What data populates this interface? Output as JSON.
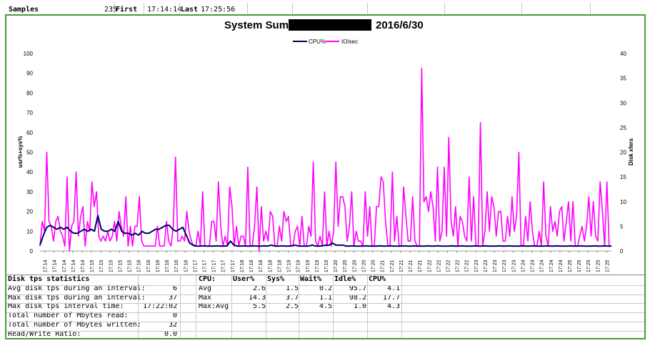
{
  "sheet_header": {
    "samples_label": "Samples",
    "samples_value": "235",
    "first_label": "First",
    "first_value": "17:14:14",
    "last_label": "Last",
    "last_value": "17:25:56"
  },
  "chart_data": {
    "type": "line",
    "title": "System Summary",
    "title_date": "2016/6/30",
    "title_redacted": true,
    "ylabel": "usr%+sys%",
    "y2label": "Disk xfers",
    "ylim": [
      0,
      100
    ],
    "y2lim": [
      0,
      40
    ],
    "yticks": [
      0,
      10,
      20,
      30,
      40,
      50,
      60,
      70,
      80,
      90,
      100
    ],
    "y2ticks": [
      0,
      5,
      10,
      15,
      20,
      25,
      30,
      35,
      40
    ],
    "legend_position": "top-center",
    "colors": {
      "cpu": "#000066",
      "io": "#ff00ff"
    },
    "x": [
      "17:14",
      "17:14",
      "17:14",
      "17:14",
      "17:14",
      "17:15",
      "17:15",
      "17:15",
      "17:15",
      "17:15",
      "17:16",
      "17:16",
      "17:16",
      "17:16",
      "17:16",
      "17:16",
      "17:17",
      "17:17",
      "17:17",
      "17:17",
      "17:17",
      "17:18",
      "17:18",
      "17:18",
      "17:18",
      "17:18",
      "17:19",
      "17:19",
      "17:19",
      "17:19",
      "17:19",
      "17:20",
      "17:20",
      "17:20",
      "17:20",
      "17:20",
      "17:21",
      "17:21",
      "17:21",
      "17:21",
      "17:21",
      "17:22",
      "17:22",
      "17:22",
      "17:22",
      "17:22",
      "17:23",
      "17:23",
      "17:23",
      "17:23",
      "17:23",
      "17:24",
      "17:24",
      "17:24",
      "17:24",
      "17:24",
      "17:25",
      "17:25",
      "17:25",
      "17:25",
      "17:25"
    ],
    "series": [
      {
        "name": "CPU%",
        "axis": "left",
        "values": [
          3,
          8,
          12,
          13,
          12,
          11,
          12,
          11,
          12,
          10,
          9,
          9,
          10,
          11,
          10,
          11,
          10,
          18,
          11,
          10,
          10,
          11,
          10,
          15,
          10,
          9,
          9,
          8,
          9,
          8,
          10,
          9,
          9,
          10,
          11,
          11,
          12,
          13,
          13,
          11,
          10,
          11,
          12,
          8,
          4,
          3,
          2.5,
          2.5,
          2.6,
          2.5,
          2.5,
          2.5,
          2.6,
          2.5,
          2.5,
          2.6,
          5,
          3,
          2.5,
          2.5,
          2.6,
          2.5,
          2.5,
          2.6,
          2.5,
          2.5,
          2.6,
          2.5,
          3,
          2.5,
          2.5,
          2.6,
          2.5,
          2.5,
          2.6,
          3,
          2.5,
          2.5,
          2.5,
          2.5,
          3,
          2.5,
          2.5,
          2.6,
          3,
          3,
          4,
          3,
          3,
          3,
          2.5,
          2.5,
          2.6,
          2.5,
          2.5,
          2.5,
          2.6,
          2.5,
          2.5,
          2.5,
          2.6,
          2.5,
          2.5,
          2.6,
          2.5,
          2.5,
          2.5,
          2.6,
          2.5,
          2.5,
          2.6,
          2.5,
          2.5,
          2.5,
          2.6,
          2.5,
          2.5,
          2.6,
          2.5,
          2.5,
          2.5,
          2.6,
          2.5,
          2.5,
          2.6,
          2.5,
          2.5,
          2.5,
          2.6,
          2.5,
          2.5,
          2.6,
          2.5,
          2.5,
          2.5,
          2.6,
          2.5,
          2.5,
          2.6,
          2.5,
          2.5,
          2.5,
          2.6,
          2.5,
          2.5,
          2.6,
          2.5,
          2.5,
          2.5,
          2.6,
          2.5,
          2.5,
          2.6,
          2.5,
          2.5,
          2.5,
          2.6,
          2.5,
          2.5,
          2.6,
          2.5,
          2.5,
          2.5,
          2.6,
          2.5,
          2.5,
          2.6,
          2.5,
          2.5
        ]
      },
      {
        "name": "IO/sec",
        "axis": "right",
        "values": [
          1,
          6,
          4,
          20,
          6,
          5,
          2,
          6,
          7,
          4,
          3,
          1,
          15,
          0,
          5,
          6,
          16,
          3,
          7,
          9,
          1,
          6,
          4,
          14,
          9,
          12,
          3,
          2,
          3,
          2,
          4,
          2,
          3,
          6,
          2,
          8,
          5,
          3,
          11,
          1,
          5,
          1,
          5,
          5,
          11,
          2,
          1,
          1,
          1,
          1,
          1,
          1,
          5,
          1,
          1,
          1,
          6,
          2,
          1,
          5,
          19,
          2,
          2,
          3,
          2,
          8,
          4,
          2,
          1,
          1,
          4,
          1,
          12,
          1,
          1,
          1,
          6,
          6,
          2,
          14,
          5,
          1,
          3,
          1,
          13,
          9,
          1,
          5,
          1,
          3,
          3,
          1,
          17,
          1,
          1,
          5,
          13,
          0,
          9,
          2,
          4,
          2,
          8,
          7,
          1,
          1,
          5,
          2,
          8,
          6,
          7,
          1,
          1,
          4,
          5,
          1,
          7,
          1,
          1,
          5,
          3,
          18,
          2,
          1,
          3,
          1,
          12,
          1,
          4,
          1,
          4,
          18,
          5,
          11,
          11,
          9,
          2,
          5,
          12,
          1,
          4,
          2,
          2,
          1,
          12,
          3,
          9,
          1,
          1,
          9,
          9,
          15,
          14,
          6,
          1,
          1,
          16,
          2,
          7,
          1,
          1,
          13,
          7,
          2,
          2,
          11,
          2,
          1,
          1,
          37,
          10,
          11,
          8,
          12,
          9,
          2,
          17,
          2,
          4,
          17,
          3,
          23,
          6,
          3,
          9,
          1,
          7,
          6,
          3,
          2,
          15,
          2,
          11,
          1,
          1,
          26,
          1,
          4,
          12,
          4,
          11,
          9,
          3,
          8,
          8,
          2,
          2,
          7,
          3,
          11,
          4,
          7,
          20,
          1,
          1,
          7,
          2,
          10,
          4,
          1,
          1,
          4,
          1,
          14,
          3,
          1,
          9,
          4,
          6,
          3,
          8,
          9,
          2,
          6,
          10,
          2,
          10,
          1,
          1,
          3,
          5,
          2,
          5,
          11,
          3,
          10,
          3,
          2,
          14,
          8,
          1,
          14,
          1,
          1
        ]
      }
    ]
  },
  "disk_stats": {
    "title": "Disk tps statistics",
    "rows": [
      {
        "label": "Avg disk tps during an interval:",
        "value": "6"
      },
      {
        "label": "Max disk tps during an interval:",
        "value": "37"
      },
      {
        "label": "Max disk tps interval time:",
        "value": "17:22:02"
      },
      {
        "label": "Total number of Mbytes read:",
        "value": "0"
      },
      {
        "label": "Total number of Mbytes written:",
        "value": "32"
      },
      {
        "label": "Read/Write Ratio:",
        "value": "0.0"
      }
    ]
  },
  "cpu_stats": {
    "headers": [
      "CPU:",
      "User%",
      "Sys%",
      "Wait%",
      "Idle%",
      "CPU%"
    ],
    "rows": [
      {
        "label": "Avg",
        "values": [
          "2.6",
          "1.5",
          "0.2",
          "95.7",
          "4.1"
        ]
      },
      {
        "label": "Max",
        "values": [
          "14.3",
          "3.7",
          "1.1",
          "98.2",
          "17.7"
        ]
      },
      {
        "label": "Max:Avg",
        "values": [
          "5.5",
          "2.5",
          "4.5",
          "1.0",
          "4.3"
        ]
      }
    ]
  }
}
